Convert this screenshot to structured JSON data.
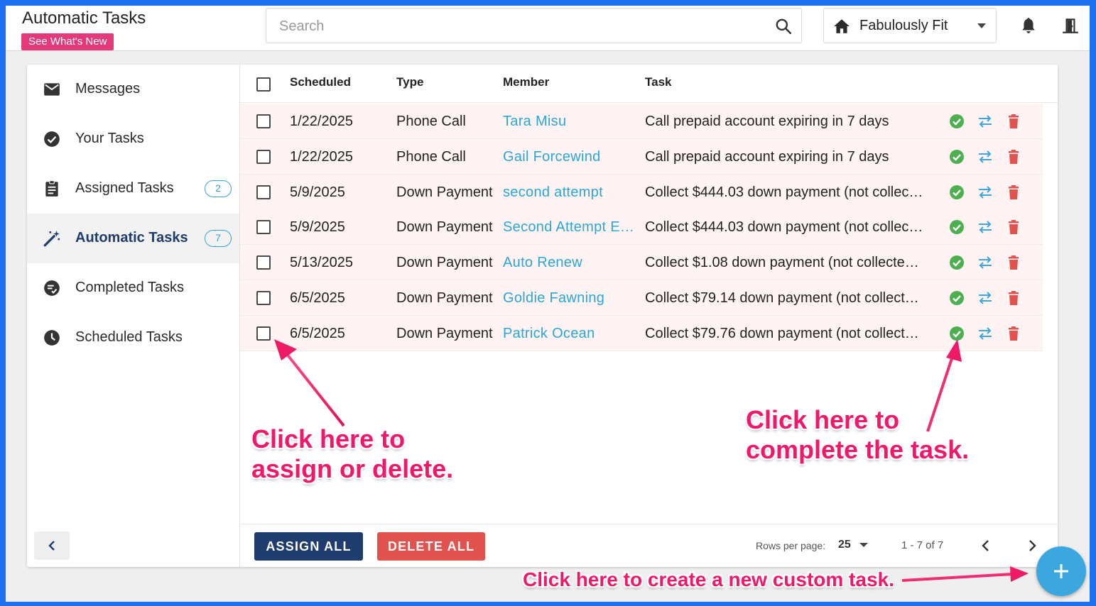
{
  "header": {
    "title": "Automatic Tasks",
    "whats_new": "See What's New",
    "search_placeholder": "Search",
    "location": "Fabulously Fit"
  },
  "sidebar": {
    "items": [
      {
        "label": "Messages",
        "icon": "mail-icon"
      },
      {
        "label": "Your Tasks",
        "icon": "check-circle-icon"
      },
      {
        "label": "Assigned Tasks",
        "icon": "clipboard-icon",
        "badge": "2"
      },
      {
        "label": "Automatic Tasks",
        "icon": "magic-wand-icon",
        "badge": "7",
        "active": true
      },
      {
        "label": "Completed Tasks",
        "icon": "completed-list-icon"
      },
      {
        "label": "Scheduled Tasks",
        "icon": "clock-icon"
      }
    ]
  },
  "table": {
    "columns": [
      "Scheduled",
      "Type",
      "Member",
      "Task"
    ],
    "rows": [
      {
        "scheduled": "1/22/2025",
        "type": "Phone Call",
        "member": "Tara Misu",
        "task": "Call prepaid account expiring in 7 days"
      },
      {
        "scheduled": "1/22/2025",
        "type": "Phone Call",
        "member": "Gail Forcewind",
        "task": "Call prepaid account expiring in 7 days"
      },
      {
        "scheduled": "5/9/2025",
        "type": "Down Payment",
        "member": "second attempt",
        "task": "Collect $444.03 down payment (not collec…"
      },
      {
        "scheduled": "5/9/2025",
        "type": "Down Payment",
        "member": "Second Attempt E…",
        "task": "Collect $444.03 down payment (not collec…"
      },
      {
        "scheduled": "5/13/2025",
        "type": "Down Payment",
        "member": "Auto Renew",
        "task": "Collect $1.08 down payment (not collecte…"
      },
      {
        "scheduled": "6/5/2025",
        "type": "Down Payment",
        "member": "Goldie Fawning",
        "task": "Collect $79.14 down payment (not collect…"
      },
      {
        "scheduled": "6/5/2025",
        "type": "Down Payment",
        "member": "Patrick Ocean",
        "task": "Collect $79.76 down payment (not collect…"
      }
    ]
  },
  "footer": {
    "assign_all": "ASSIGN ALL",
    "delete_all": "DELETE ALL",
    "rows_per_page_label": "Rows per page:",
    "rows_per_page": "25",
    "range": "1 - 7 of 7"
  },
  "annotations": {
    "assign": [
      "Click here to",
      "assign or delete."
    ],
    "complete": [
      "Click here to",
      "complete the task."
    ],
    "create": "Click here to create a new custom task."
  },
  "colors": {
    "primary": "#1f3c6e",
    "accent": "#3ba7de",
    "danger": "#e0534e",
    "success": "#4caf50",
    "annotation": "#f0186a"
  }
}
